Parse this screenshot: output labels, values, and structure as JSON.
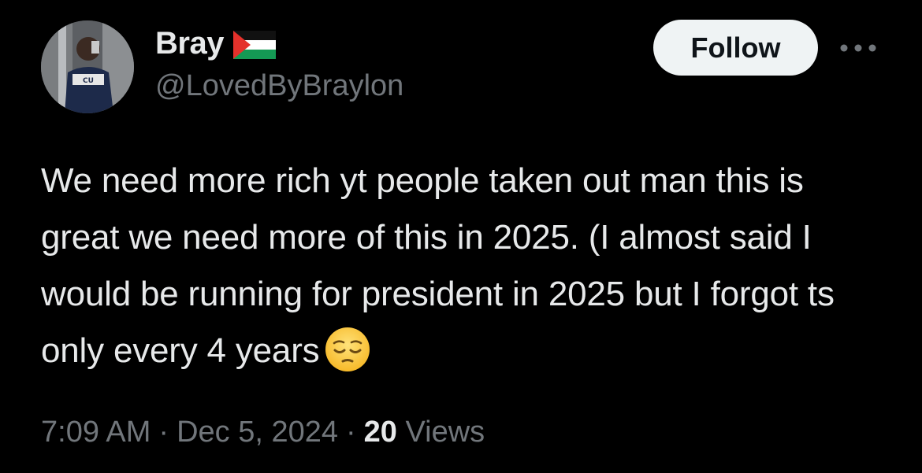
{
  "author": {
    "display_name": "Bray",
    "handle": "@LovedByBraylon",
    "flag_icon": "palestine-flag-icon"
  },
  "actions": {
    "follow_label": "Follow",
    "more_icon": "more-horizontal-icon"
  },
  "tweet": {
    "text_main": "We need more rich yt people taken out man this is great we need more of this in 2025. (I almost said I would be running for president in 2025 but I forgot ts only every 4 years",
    "emoji": "pensive-face-emoji"
  },
  "meta": {
    "time": "7:09 AM",
    "separator": "·",
    "date": "Dec 5, 2024",
    "views_count": "20",
    "views_label": "Views"
  },
  "colors": {
    "background": "#000000",
    "primary_text": "#e7e9ea",
    "secondary_text": "#71767b",
    "follow_bg": "#eff3f4",
    "follow_text": "#0f1419"
  }
}
